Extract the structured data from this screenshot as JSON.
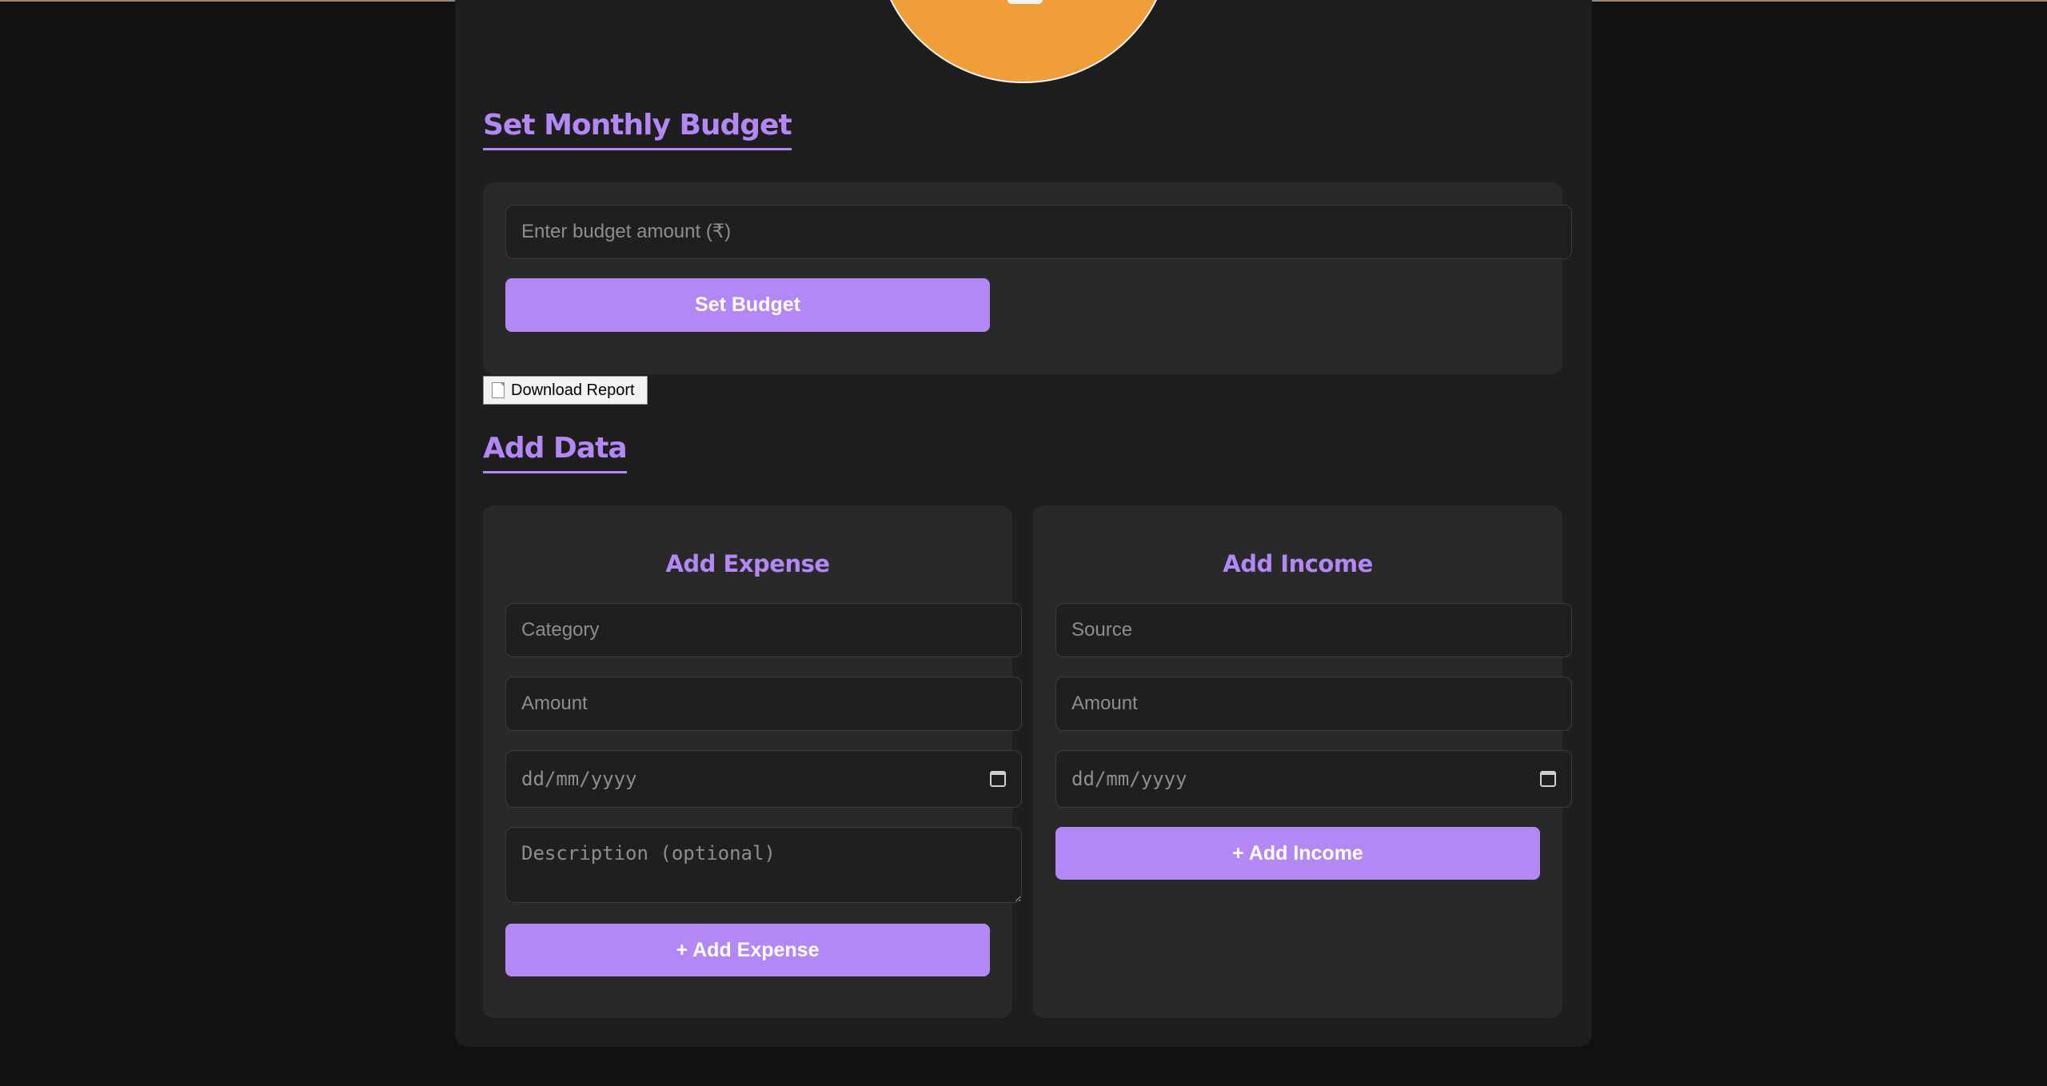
{
  "budget": {
    "title": "Set Monthly Budget",
    "amount_placeholder": "Enter budget amount (₹)",
    "set_button": "Set Budget"
  },
  "download_button": "Download Report",
  "add_data": {
    "title": "Add Data",
    "expense": {
      "title": "Add Expense",
      "category_placeholder": "Category",
      "amount_placeholder": "Amount",
      "date_placeholder": "dd/mm/yyyy",
      "description_placeholder": "Description (optional)",
      "button": "+ Add Expense"
    },
    "income": {
      "title": "Add Income",
      "source_placeholder": "Source",
      "amount_placeholder": "Amount",
      "date_placeholder": "dd/mm/yyyy",
      "button": "+ Add Income"
    }
  },
  "icons": {
    "download": "document-icon",
    "date": "calendar-icon"
  },
  "colors": {
    "accent": "#b388f5",
    "chart_slice": "#f09e3a",
    "page_background": "#111111",
    "panel_background": "#1e1e1e",
    "card_background": "#292929"
  }
}
